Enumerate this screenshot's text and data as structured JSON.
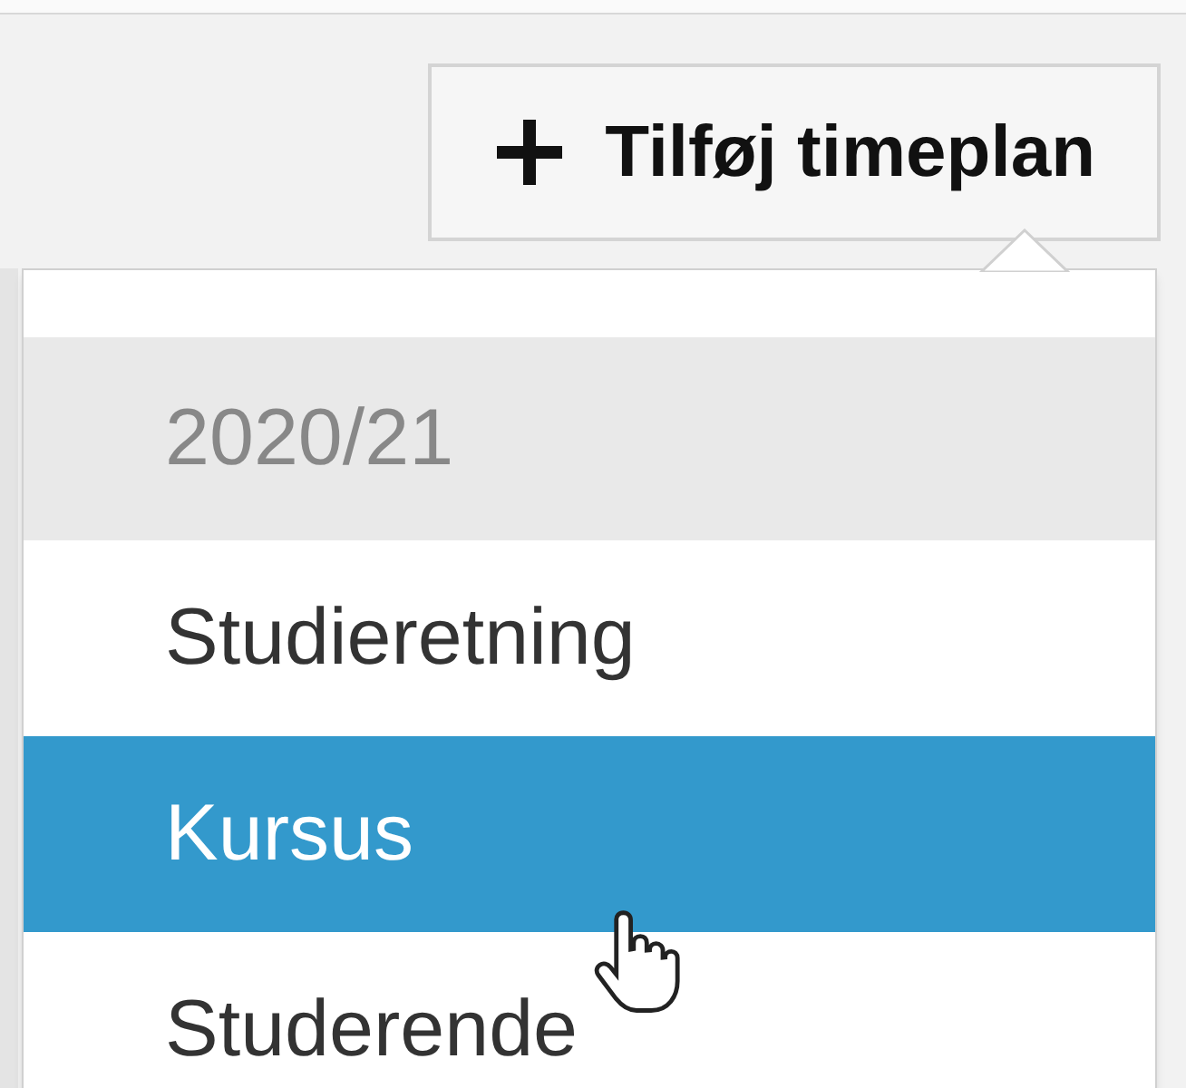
{
  "add_button": {
    "label": "Tilføj timeplan"
  },
  "menu": {
    "header": "2020/21",
    "items": [
      {
        "label": "Studieretning",
        "selected": false
      },
      {
        "label": "Kursus",
        "selected": true
      },
      {
        "label": "Studerende",
        "selected": false
      }
    ]
  }
}
